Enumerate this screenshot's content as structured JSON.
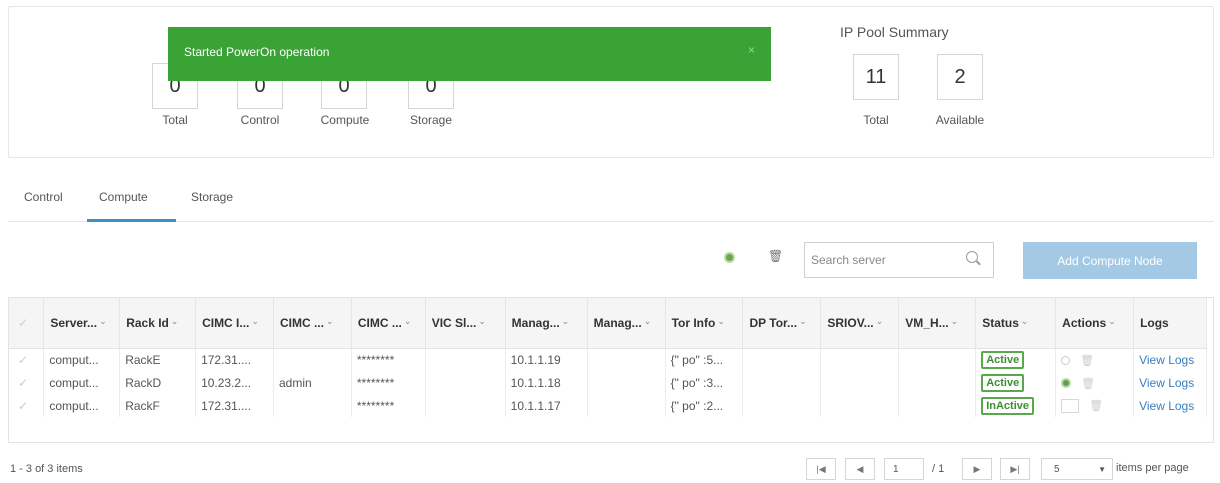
{
  "toast": {
    "message": "Started PowerOn operation",
    "close_glyph": "×"
  },
  "server_summary": {
    "counts": [
      {
        "value": "0",
        "label": "Total"
      },
      {
        "value": "0",
        "label": "Control"
      },
      {
        "value": "0",
        "label": "Compute"
      },
      {
        "value": "0",
        "label": "Storage"
      }
    ]
  },
  "ip_pool": {
    "title": "IP Pool Summary",
    "counts": [
      {
        "value": "11",
        "label": "Total"
      },
      {
        "value": "2",
        "label": "Available"
      }
    ]
  },
  "tabs": [
    {
      "label": "Control",
      "active": false
    },
    {
      "label": "Compute",
      "active": true
    },
    {
      "label": "Storage",
      "active": false
    }
  ],
  "toolbar": {
    "search_placeholder": "Search server",
    "add_button": "Add Compute Node"
  },
  "table": {
    "columns": [
      "Server...",
      "Rack Id",
      "CIMC I...",
      "CIMC ...",
      "CIMC ...",
      "VIC Sl...",
      "Manag...",
      "Manag...",
      "Tor Info",
      "DP Tor...",
      "SRIOV...",
      "VM_H...",
      "Status",
      "Actions",
      "Logs"
    ],
    "rows": [
      {
        "server": "comput...",
        "rack": "RackE",
        "cimc_ip": "172.31....",
        "cimc_user": "",
        "cimc_pw": "********",
        "vic": "",
        "mgmt_ip": "10.1.1.19",
        "mgmt2": "",
        "tor": "{\" po\" :5...",
        "dp_tor": "",
        "sriov": "",
        "vm_h": "",
        "status": "Active",
        "logs": "View Logs"
      },
      {
        "server": "comput...",
        "rack": "RackD",
        "cimc_ip": "10.23.2...",
        "cimc_user": "admin",
        "cimc_pw": "********",
        "vic": "",
        "mgmt_ip": "10.1.1.18",
        "mgmt2": "",
        "tor": "{\" po\" :3...",
        "dp_tor": "",
        "sriov": "",
        "vm_h": "",
        "status": "Active",
        "logs": "View Logs"
      },
      {
        "server": "comput...",
        "rack": "RackF",
        "cimc_ip": "172.31....",
        "cimc_user": "",
        "cimc_pw": "********",
        "vic": "",
        "mgmt_ip": "10.1.1.17",
        "mgmt2": "",
        "tor": "{\" po\" :2...",
        "dp_tor": "",
        "sriov": "",
        "vm_h": "",
        "status": "InActive",
        "logs": "View Logs"
      }
    ]
  },
  "pagination": {
    "summary": "1 - 3 of 3 items",
    "current_page": "1",
    "of_pages": "/ 1",
    "page_size": "5",
    "per_page_label": "items per page",
    "first_glyph": "|◀",
    "prev_glyph": "◀",
    "next_glyph": "▶",
    "last_glyph": "▶|"
  },
  "icons": {
    "power_on_color": "#5f9f45",
    "accent": "#3a8fc4",
    "toast_color": "#3aa335"
  }
}
